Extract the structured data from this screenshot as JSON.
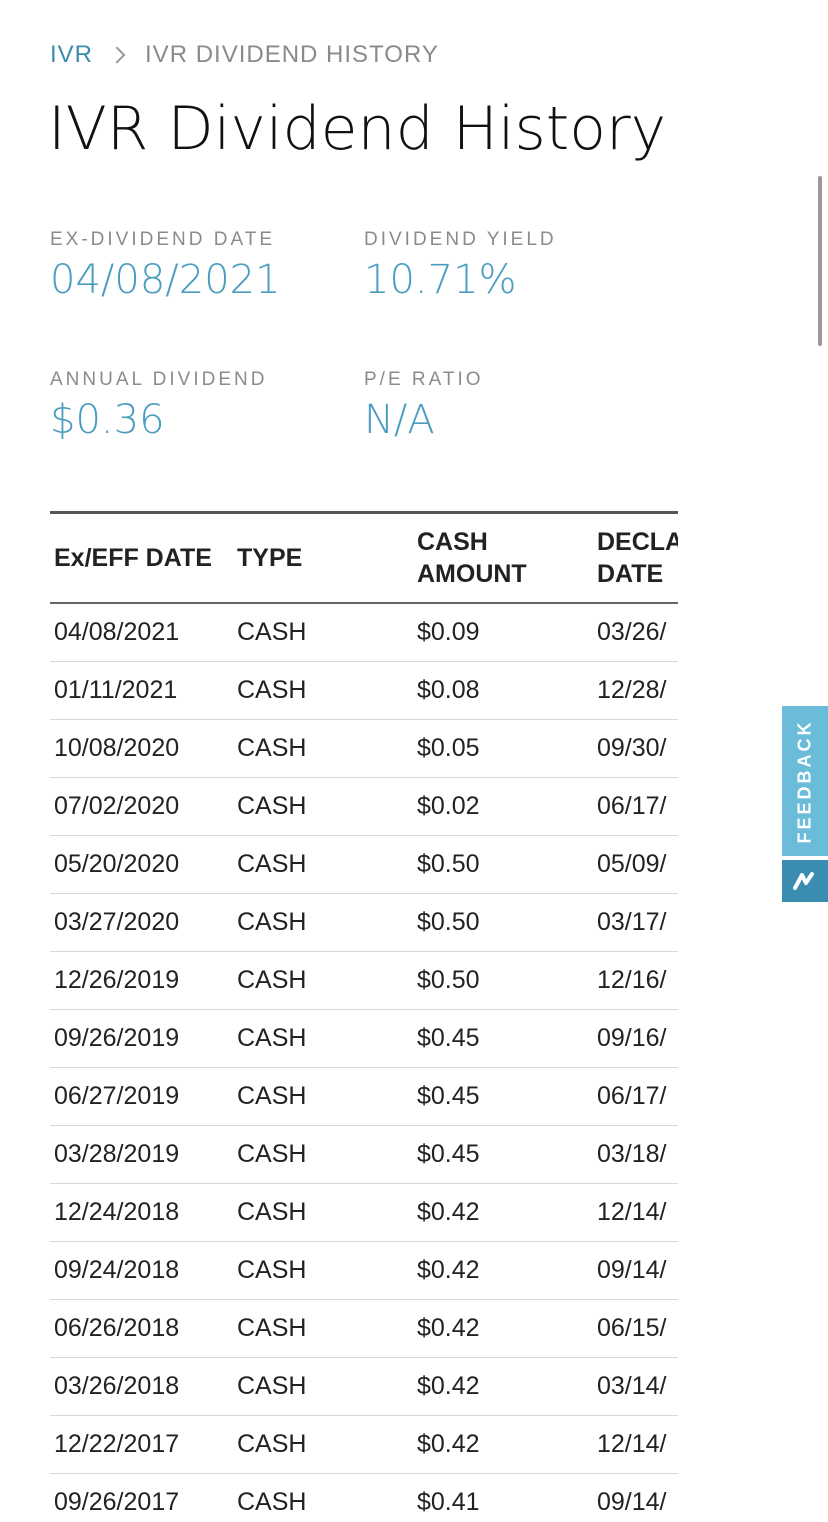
{
  "breadcrumb": {
    "root": "IVR",
    "current": "IVR DIVIDEND HISTORY"
  },
  "title": "IVR Dividend History",
  "stats": {
    "ex_dividend_date": {
      "label": "EX-DIVIDEND DATE",
      "value": "04/08/2021"
    },
    "dividend_yield": {
      "label": "DIVIDEND YIELD",
      "value": "10.71%"
    },
    "annual_dividend": {
      "label": "ANNUAL DIVIDEND",
      "value": "$0.36"
    },
    "pe_ratio": {
      "label": "P/E RATIO",
      "value": "N/A"
    }
  },
  "table": {
    "headers": [
      "Ex/EFF DATE",
      "TYPE",
      "CASH\nAMOUNT",
      "DECLARATION\nDATE"
    ],
    "rows": [
      [
        "04/08/2021",
        "CASH",
        "$0.09",
        "03/26/"
      ],
      [
        "01/11/2021",
        "CASH",
        "$0.08",
        "12/28/"
      ],
      [
        "10/08/2020",
        "CASH",
        "$0.05",
        "09/30/"
      ],
      [
        "07/02/2020",
        "CASH",
        "$0.02",
        "06/17/"
      ],
      [
        "05/20/2020",
        "CASH",
        "$0.50",
        "05/09/"
      ],
      [
        "03/27/2020",
        "CASH",
        "$0.50",
        "03/17/"
      ],
      [
        "12/26/2019",
        "CASH",
        "$0.50",
        "12/16/"
      ],
      [
        "09/26/2019",
        "CASH",
        "$0.45",
        "09/16/"
      ],
      [
        "06/27/2019",
        "CASH",
        "$0.45",
        "06/17/"
      ],
      [
        "03/28/2019",
        "CASH",
        "$0.45",
        "03/18/"
      ],
      [
        "12/24/2018",
        "CASH",
        "$0.42",
        "12/14/"
      ],
      [
        "09/24/2018",
        "CASH",
        "$0.42",
        "09/14/"
      ],
      [
        "06/26/2018",
        "CASH",
        "$0.42",
        "06/15/"
      ],
      [
        "03/26/2018",
        "CASH",
        "$0.42",
        "03/14/"
      ],
      [
        "12/22/2017",
        "CASH",
        "$0.42",
        "12/14/"
      ],
      [
        "09/26/2017",
        "CASH",
        "$0.41",
        "09/14/"
      ]
    ]
  },
  "feedback": {
    "label": "FEEDBACK",
    "icon": "brand-logo-icon"
  },
  "colors": {
    "accent": "#4a9cc0",
    "link": "#3a8db0",
    "feedback_tab": "#6bbcd8"
  }
}
